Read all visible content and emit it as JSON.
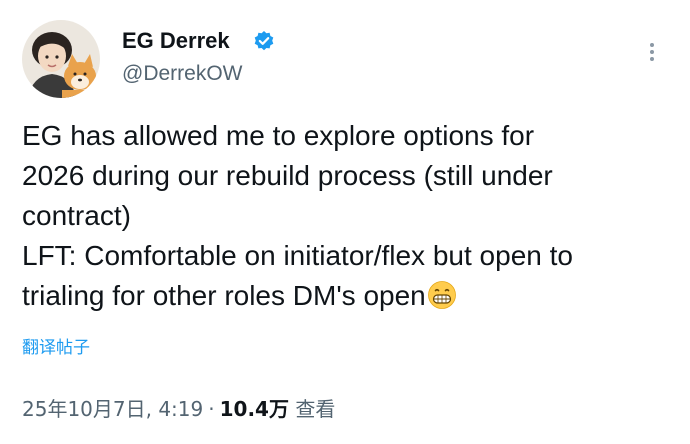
{
  "author": {
    "display_name": "EG Derrek",
    "handle": "@DerrekOW",
    "verified": true,
    "avatar_icon": "avatar-person-with-dog"
  },
  "tweet": {
    "lines": [
      "EG has allowed me to explore options for",
      "2026 during our rebuild process (still under",
      "contract)",
      "LFT: Comfortable on initiator/flex but open to",
      "trialing for other roles DM's open"
    ],
    "trailing_emoji": "grinning-face-emoji"
  },
  "translate_label": "翻译帖子",
  "meta": {
    "timestamp": "25年10月7日, 4:19",
    "separator": "·",
    "views_count": "10.4万",
    "views_label": "查看"
  },
  "colors": {
    "text": "#0f1419",
    "secondary": "#536471",
    "link": "#1d9bf0",
    "verified": "#1d9bf0"
  }
}
